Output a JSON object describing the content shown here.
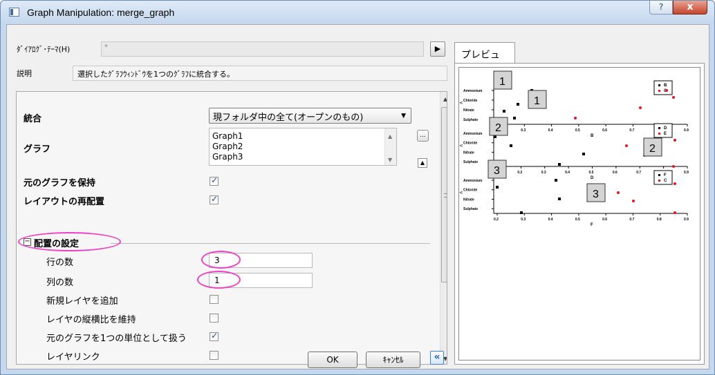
{
  "window": {
    "title": "Graph Manipulation: merge_graph",
    "help_label": "?",
    "close_label": "x"
  },
  "header": {
    "theme_label": "ﾀﾞｲｱﾛｸﾞ･ﾃｰﾏ(H)",
    "theme_value": "*",
    "arrow_label": "▶",
    "desc_label": "説明",
    "desc_value": "選択したｸﾞﾗﾌｳｨﾝﾄﾞｳを1つのｸﾞﾗﾌに統合する。"
  },
  "settings": {
    "merge_label": "統合",
    "merge_value": "現フォルダ中の全て(オープンのもの)",
    "graphs_label": "グラフ",
    "graphs": [
      "Graph1",
      "Graph2",
      "Graph3"
    ],
    "dots_label": "...",
    "keep_label": "元のグラフを保持",
    "keep_checked": true,
    "relayout_label": "レイアウトの再配置",
    "relayout_checked": true,
    "arrange_label": "配置の設定",
    "arrange_toggle": "−",
    "rows_label": "行の数",
    "rows_value": "3",
    "cols_label": "列の数",
    "cols_value": "1",
    "addlayer_label": "新規レイヤを追加",
    "addlayer_checked": false,
    "aspect_label": "レイヤの縦横比を維持",
    "aspect_checked": false,
    "unit_label": "元のグラフを1つの単位として扱う",
    "unit_checked": true,
    "link_label": "レイヤリンク",
    "link_checked": false
  },
  "buttons": {
    "ok": "OK",
    "cancel": "ｷｬﾝｾﾙ",
    "collapse": "«"
  },
  "preview": {
    "tab_label": "プレビュー",
    "layers": [
      {
        "num": "1",
        "ylabels": [
          "Ammonium",
          "Chloride",
          "Nitrate",
          "Sulphate"
        ],
        "ticks": [
          "0.2",
          "0.3",
          "0.4",
          "0.5",
          "0.6",
          "0.7",
          "0.8",
          "0.9"
        ],
        "xlabel": "B",
        "legend": [
          "B",
          "C"
        ]
      },
      {
        "num": "2",
        "ylabels": [
          "Ammonium",
          "Chloride",
          "Nitrate",
          "Sulphate"
        ],
        "ticks": [
          "0.1",
          "0.2",
          "0.3",
          "0.4",
          "0.5",
          "0.6",
          "0.7",
          "0.8",
          "0.9"
        ],
        "xlabel": "D",
        "legend": [
          "D",
          "E"
        ]
      },
      {
        "num": "3",
        "ylabels": [
          "Ammonium",
          "Chloride",
          "Nitrate",
          "Sulphate"
        ],
        "ticks": [
          "0.2",
          "0.3",
          "0.4",
          "0.5",
          "0.6",
          "0.7",
          "0.8",
          "0.9"
        ],
        "xlabel": "F",
        "legend": [
          "F",
          "C"
        ]
      }
    ],
    "colors": {
      "black_series": "#000000",
      "red_series": "#e8141c"
    }
  }
}
